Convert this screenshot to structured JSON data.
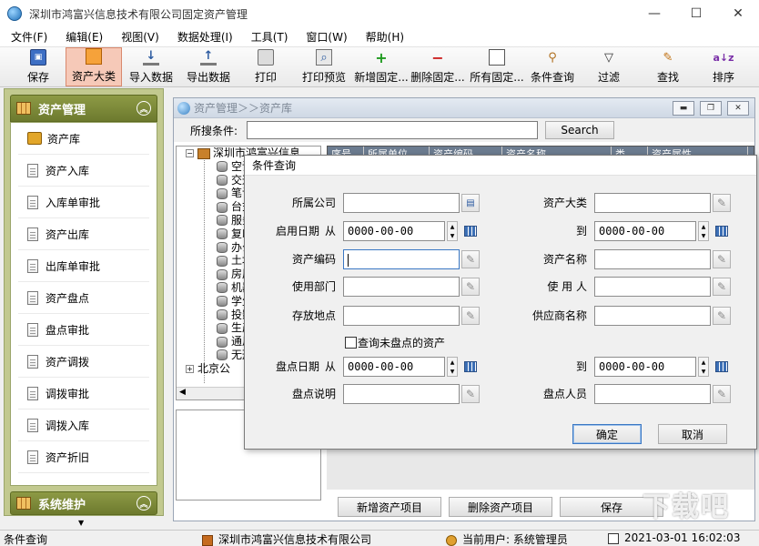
{
  "window": {
    "title": "深圳市鸿富兴信息技术有限公司固定资产管理",
    "minimize": "—",
    "maximize": "☐",
    "close": "✕"
  },
  "menu": [
    "文件(F)",
    "编辑(E)",
    "视图(V)",
    "数据处理(I)",
    "工具(T)",
    "窗口(W)",
    "帮助(H)"
  ],
  "toolbar": {
    "buttons": [
      {
        "label": "保存",
        "icon": "save-icon"
      },
      {
        "label": "资产大类",
        "icon": "category-icon",
        "active": true
      },
      {
        "label": "导入数据",
        "icon": "import-icon"
      },
      {
        "label": "导出数据",
        "icon": "export-icon"
      },
      {
        "label": "打印",
        "icon": "print-icon"
      },
      {
        "label": "打印预览",
        "icon": "print-preview-icon"
      },
      {
        "label": "新增固定...",
        "icon": "add-icon"
      },
      {
        "label": "删除固定...",
        "icon": "delete-icon"
      },
      {
        "label": "所有固定...",
        "icon": "all-assets-icon"
      },
      {
        "label": "条件查询",
        "icon": "query-icon"
      },
      {
        "label": "过滤",
        "icon": "filter-icon"
      },
      {
        "label": "查找",
        "icon": "find-icon"
      },
      {
        "label": "排序",
        "icon": "sort-icon"
      }
    ]
  },
  "sidebar": {
    "header": "资产管理",
    "items": [
      "资产库",
      "资产入库",
      "入库单审批",
      "资产出库",
      "出库单审批",
      "资产盘点",
      "盘点审批",
      "资产调拨",
      "调拨审批",
      "调拨入库",
      "资产折旧"
    ],
    "footer": "系统维护"
  },
  "child_window": {
    "title": "资产管理＞＞资产库",
    "search_label": "所搜条件:",
    "search_value": "",
    "search_button": "Search",
    "tree": {
      "root": "深圳市鸿富兴信息",
      "children": [
        "空调",
        "交通",
        "笔记",
        "台式",
        "服务",
        "复印",
        "办公",
        "土地",
        "房屋",
        "机器",
        "学生",
        "投影",
        "生产",
        "通用",
        "无形"
      ],
      "second_root": "北京公"
    },
    "grid_headers": [
      "序号",
      "所属单位",
      "资产编码",
      "资产名称",
      "类",
      "资产属性"
    ],
    "bottom_buttons": [
      "新增资产项目",
      "删除资产项目",
      "保存"
    ]
  },
  "dialog": {
    "title": "条件查询",
    "fields": {
      "company_label": "所属公司",
      "category_label": "资产大类",
      "start_date_label": "启用日期",
      "from_label": "从",
      "to_label": "到",
      "start_from": "0000-00-00",
      "start_to": "0000-00-00",
      "code_label": "资产编码",
      "name_label": "资产名称",
      "dept_label": "使用部门",
      "user_label": "使 用 人",
      "location_label": "存放地点",
      "supplier_label": "供应商名称",
      "uncounted_label": "查询未盘点的资产",
      "count_date_label": "盘点日期",
      "count_from": "0000-00-00",
      "count_to": "0000-00-00",
      "count_note_label": "盘点说明",
      "counter_label": "盘点人员"
    },
    "ok_button": "确定",
    "cancel_button": "取消"
  },
  "statusbar": {
    "status": "条件查询",
    "company": "深圳市鸿富兴信息技术有限公司",
    "user": "当前用户: 系统管理员",
    "datetime": "2021-03-01 16:02:03"
  },
  "watermark": "下载吧"
}
